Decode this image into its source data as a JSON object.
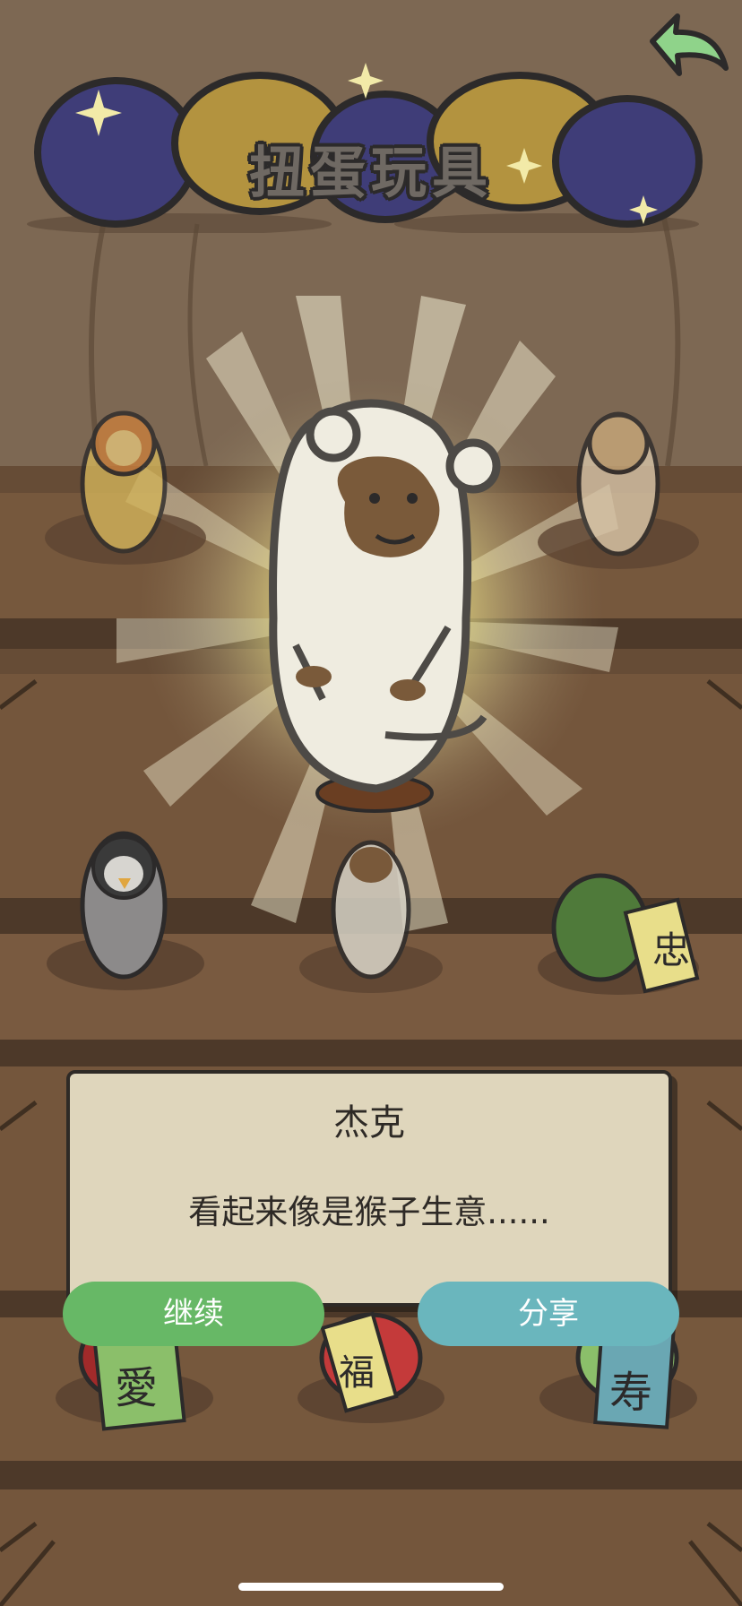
{
  "header": {
    "title": "扭蛋玩具",
    "back_icon": "back-arrow-icon"
  },
  "shelf_items": [
    {
      "name": "lion-figure",
      "label": ""
    },
    {
      "name": "dog-figure",
      "label": ""
    },
    {
      "name": "penguin-figure",
      "label": ""
    },
    {
      "name": "monkey-mini-figure",
      "label": ""
    },
    {
      "name": "durian-figure",
      "label": "忠"
    },
    {
      "name": "red-figure",
      "label": "愛"
    },
    {
      "name": "apple-figure",
      "label": "福"
    },
    {
      "name": "melon-figure",
      "label": "寿"
    }
  ],
  "featured_toy": {
    "name": "杰克",
    "description": "看起来像是猴子生意......"
  },
  "buttons": {
    "continue_label": "继续",
    "share_label": "分享"
  },
  "colors": {
    "continue": "#67b866",
    "share": "#6ab6bd",
    "dialog_bg": "#dfd6bc",
    "shelf": "#7a5a3e"
  }
}
